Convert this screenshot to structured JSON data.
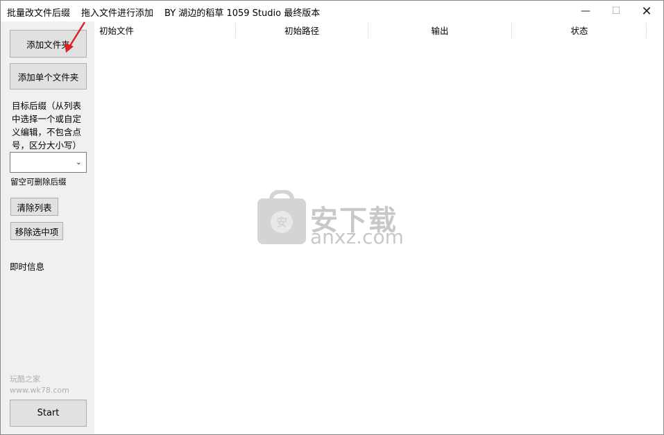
{
  "titlebar": {
    "app_title": "批量改文件后缀",
    "drag_hint": "拖入文件进行添加",
    "credit": "BY 湖边的稻草 1059 Studio 最终版本",
    "minimize": "—",
    "maximize": "☐",
    "close": "✕"
  },
  "sidebar": {
    "add_folder": "添加文件夹",
    "add_single_folder": "添加单个文件夹",
    "suffix_label": "目标后缀（从列表中选择一个或自定义编辑，不包含点号，区分大小写）",
    "suffix_value": "",
    "suffix_hint": "留空可删除后缀",
    "clear_list": "清除列表",
    "remove_selected": "移除选中项",
    "info_label": "即时信息",
    "watermark_line1": "玩酷之家",
    "watermark_line2": "www.wk78.com",
    "start": "Start"
  },
  "list": {
    "columns": [
      "初始文件",
      "初始路径",
      "输出",
      "状态"
    ]
  },
  "watermark": {
    "badge": "安",
    "text": "安下载",
    "domain": "anxz.com"
  }
}
